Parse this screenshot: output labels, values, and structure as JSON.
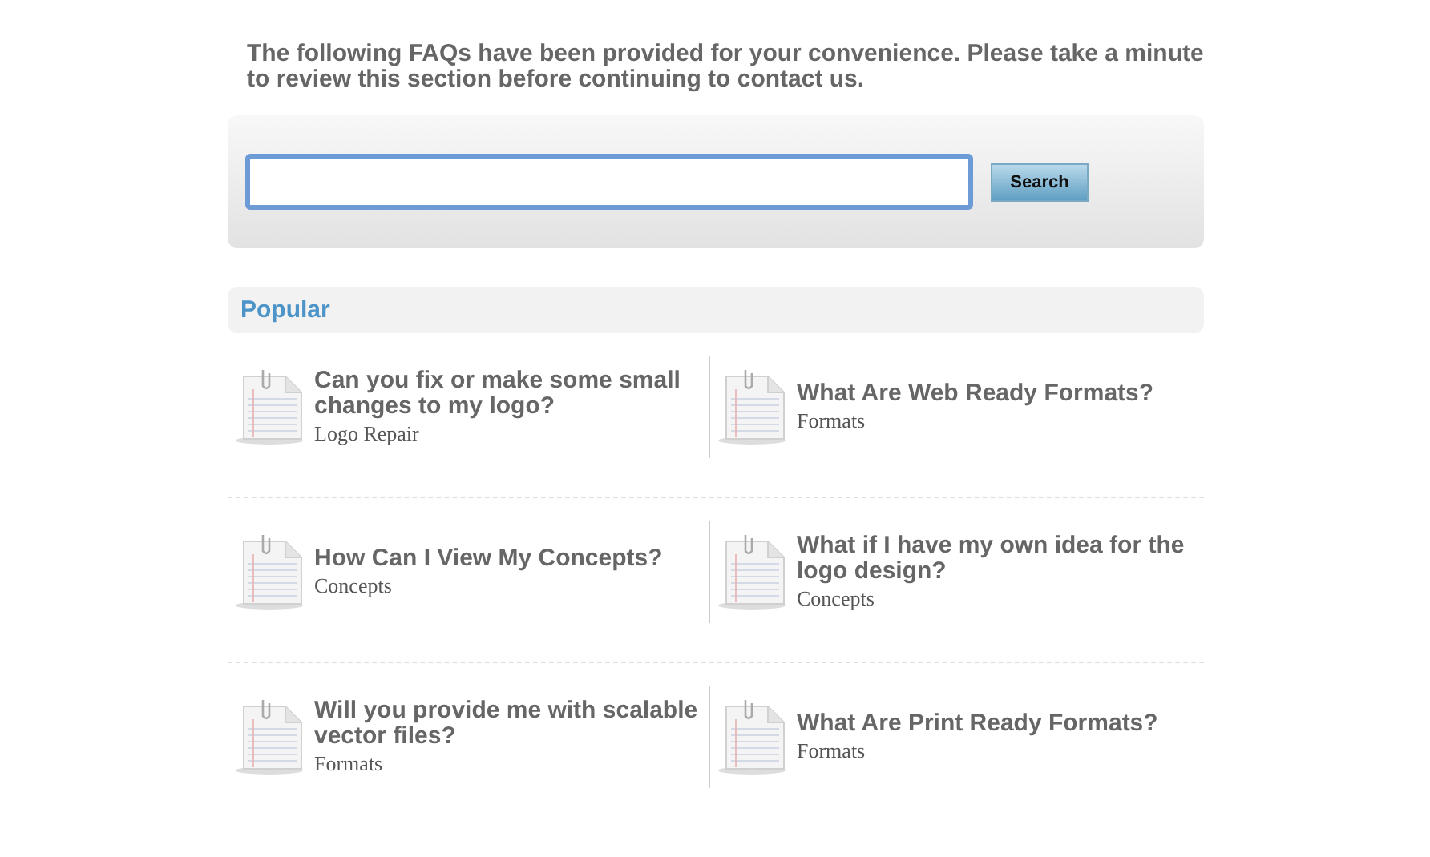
{
  "intro": "The following FAQs have been provided for your convenience. Please take a minute to review this section before continuing to contact us.",
  "search": {
    "button": "Search"
  },
  "section_title": "Popular",
  "rows": [
    [
      {
        "question": "Can you fix or make some small changes to my logo?",
        "category": "Logo Repair"
      },
      {
        "question": "What Are Web Ready Formats?",
        "category": "Formats"
      }
    ],
    [
      {
        "question": "How Can I View My Concepts?",
        "category": "Concepts"
      },
      {
        "question": "What if I have my own idea for the logo design?",
        "category": "Concepts"
      }
    ],
    [
      {
        "question": "Will you provide me with scalable vector files?",
        "category": "Formats"
      },
      {
        "question": "What Are Print Ready Formats?",
        "category": "Formats"
      }
    ]
  ]
}
